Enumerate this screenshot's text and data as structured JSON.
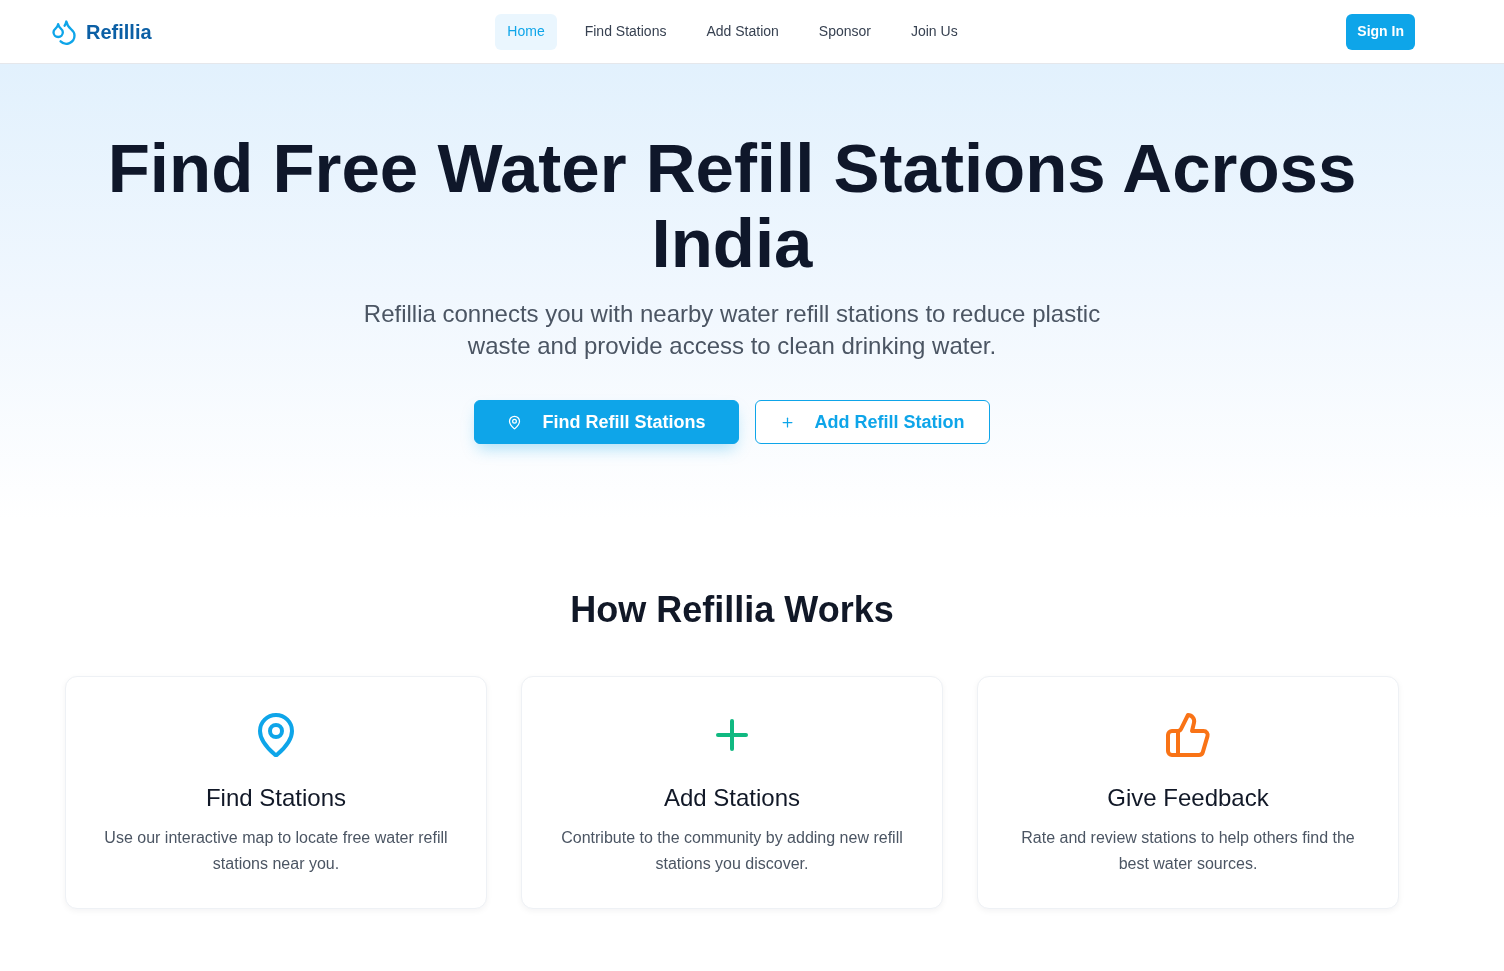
{
  "header": {
    "logo": "Refillia",
    "nav": [
      {
        "label": "Home",
        "selected": true
      },
      {
        "label": "Find Stations",
        "selected": false
      },
      {
        "label": "Add Station",
        "selected": false
      },
      {
        "label": "Sponsor",
        "selected": false
      },
      {
        "label": "Join Us",
        "selected": false
      }
    ],
    "sign_in": "Sign In"
  },
  "hero": {
    "title": "Find Free Water Refill Stations Across India",
    "subtitle": "Refillia connects you with nearby water refill stations to reduce plastic waste and provide access to clean drinking water.",
    "buttons": [
      {
        "label": "Find Refill Stations",
        "kind": "primary"
      },
      {
        "label": "Add Refill Station",
        "kind": "outline"
      }
    ]
  },
  "how_it_works": {
    "title": "How Refillia Works",
    "cards": [
      {
        "title": "Find Stations",
        "text": "Use our interactive map to locate free water refill stations near you.",
        "color": "#0ea5e9"
      },
      {
        "title": "Add Stations",
        "text": "Contribute to the community by adding new refill stations you discover.",
        "color": "#10b981"
      },
      {
        "title": "Give Feedback",
        "text": "Rate and review stations to help others find the best water sources.",
        "color": "#f97316"
      }
    ]
  }
}
